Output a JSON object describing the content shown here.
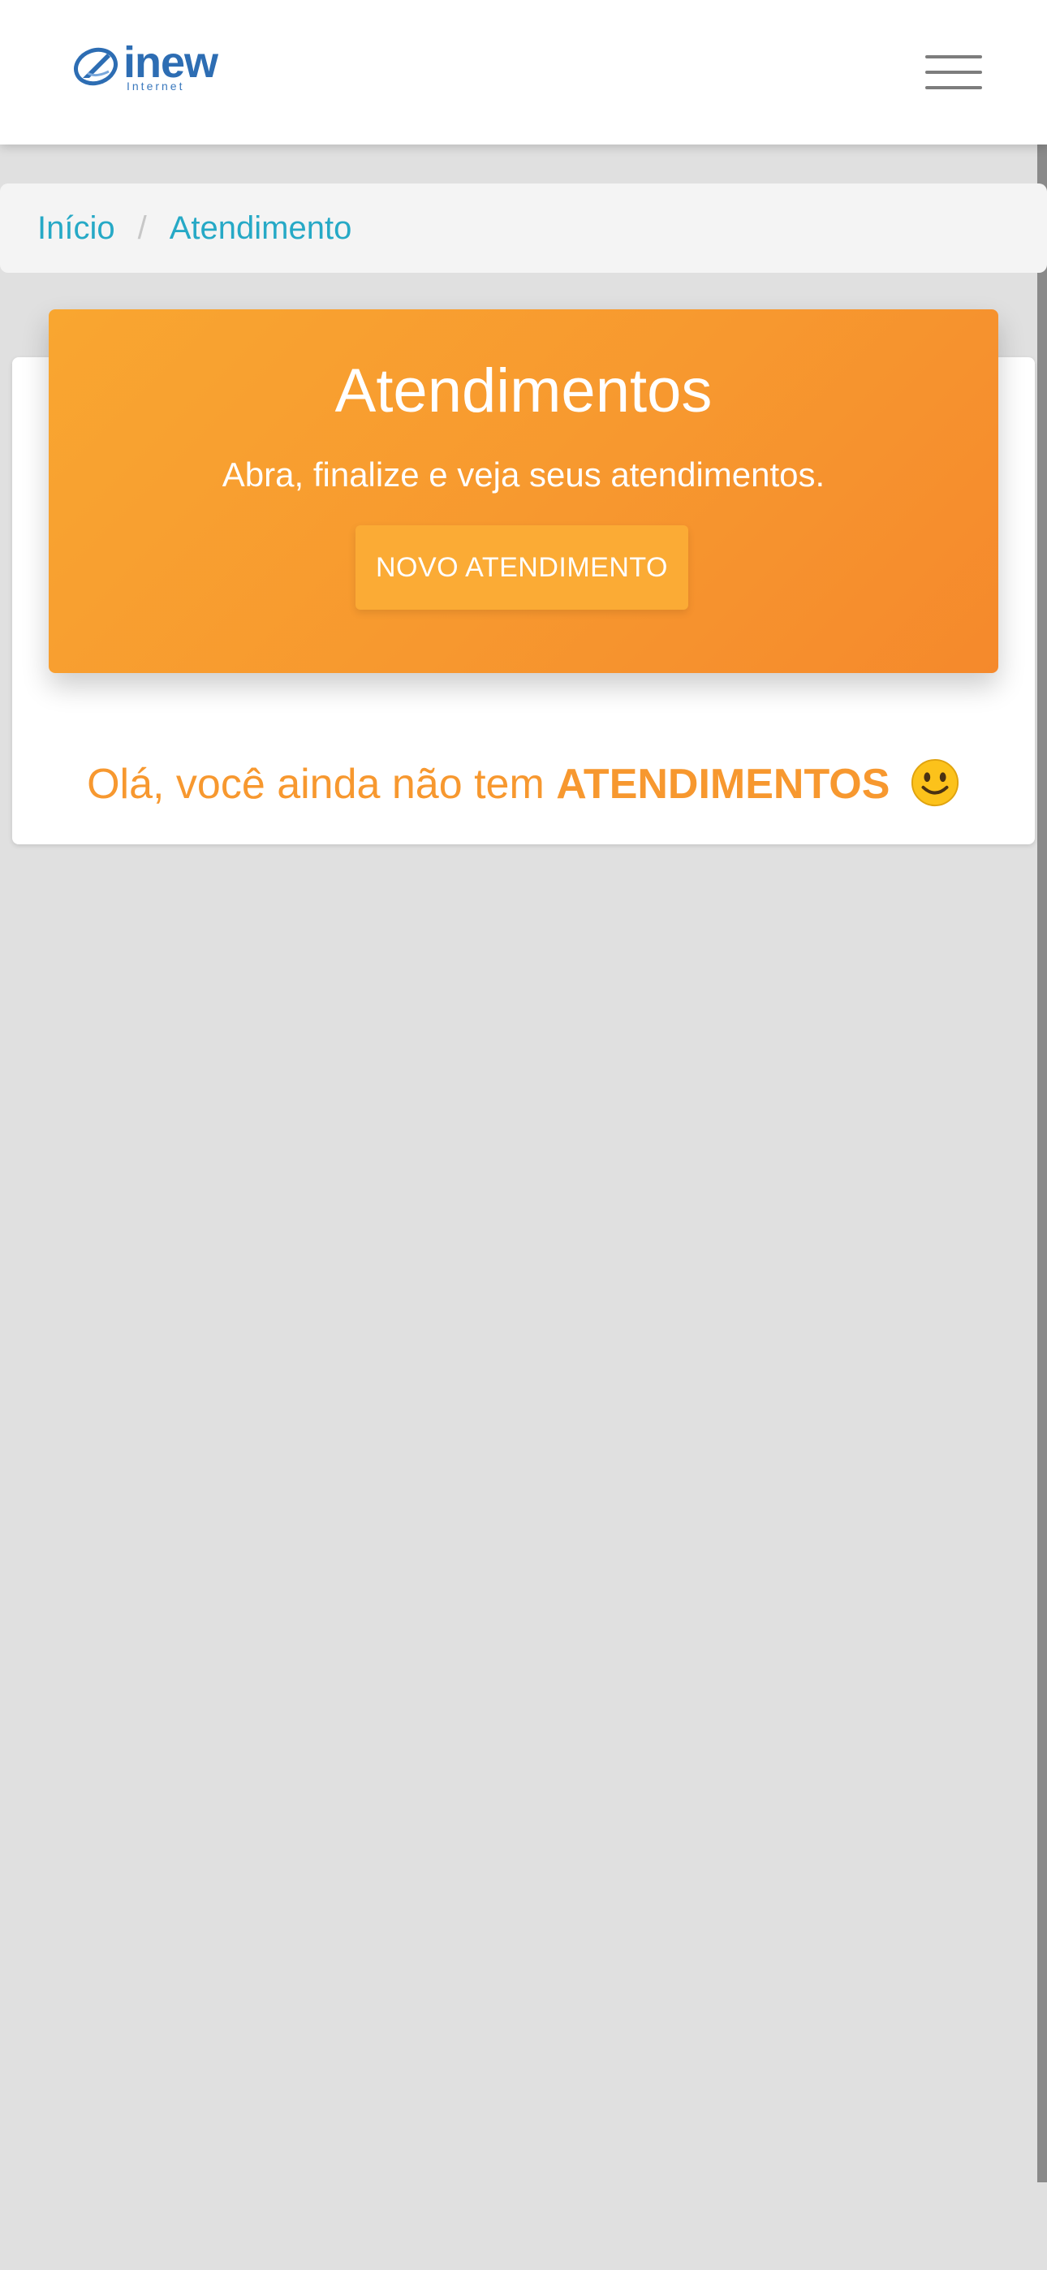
{
  "header": {
    "logo_text": "inew",
    "logo_sub": "Internet",
    "menu_icon": "hamburger-menu-icon"
  },
  "breadcrumb": {
    "items": [
      "Início",
      "Atendimento"
    ],
    "separator": "/"
  },
  "banner": {
    "title": "Atendimentos",
    "subtitle": "Abra, finalize e veja seus atendimentos.",
    "button_label": "NOVO ATENDIMENTO"
  },
  "empty_state": {
    "prefix": "Olá, você ainda não tem",
    "highlight": "ATENDIMENTOS",
    "emoji_icon": "smiley-face-icon"
  },
  "colors": {
    "accent_orange": "#f7982f",
    "link_blue": "#26a9c6",
    "brand_blue": "#2d6db3",
    "background": "#e0e0e0"
  }
}
